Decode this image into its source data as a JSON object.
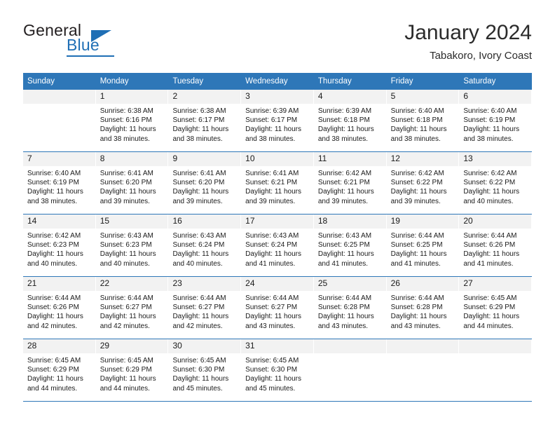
{
  "brand": {
    "word1": "General",
    "word2": "Blue",
    "triangle_color": "#1f6fb5",
    "icon": "triangle-icon"
  },
  "header": {
    "title": "January 2024",
    "subtitle": "Tabakoro, Ivory Coast"
  },
  "theme": {
    "header_bg": "#2e77b8",
    "header_text": "#ffffff",
    "daynum_bg": "#f2f2f2",
    "row_divider": "#2e77b8"
  },
  "weekdays": [
    "Sunday",
    "Monday",
    "Tuesday",
    "Wednesday",
    "Thursday",
    "Friday",
    "Saturday"
  ],
  "weeks": [
    [
      {
        "day": "",
        "sunrise": "",
        "sunset": "",
        "daylight1": "",
        "daylight2": ""
      },
      {
        "day": "1",
        "sunrise": "Sunrise: 6:38 AM",
        "sunset": "Sunset: 6:16 PM",
        "daylight1": "Daylight: 11 hours",
        "daylight2": "and 38 minutes."
      },
      {
        "day": "2",
        "sunrise": "Sunrise: 6:38 AM",
        "sunset": "Sunset: 6:17 PM",
        "daylight1": "Daylight: 11 hours",
        "daylight2": "and 38 minutes."
      },
      {
        "day": "3",
        "sunrise": "Sunrise: 6:39 AM",
        "sunset": "Sunset: 6:17 PM",
        "daylight1": "Daylight: 11 hours",
        "daylight2": "and 38 minutes."
      },
      {
        "day": "4",
        "sunrise": "Sunrise: 6:39 AM",
        "sunset": "Sunset: 6:18 PM",
        "daylight1": "Daylight: 11 hours",
        "daylight2": "and 38 minutes."
      },
      {
        "day": "5",
        "sunrise": "Sunrise: 6:40 AM",
        "sunset": "Sunset: 6:18 PM",
        "daylight1": "Daylight: 11 hours",
        "daylight2": "and 38 minutes."
      },
      {
        "day": "6",
        "sunrise": "Sunrise: 6:40 AM",
        "sunset": "Sunset: 6:19 PM",
        "daylight1": "Daylight: 11 hours",
        "daylight2": "and 38 minutes."
      }
    ],
    [
      {
        "day": "7",
        "sunrise": "Sunrise: 6:40 AM",
        "sunset": "Sunset: 6:19 PM",
        "daylight1": "Daylight: 11 hours",
        "daylight2": "and 38 minutes."
      },
      {
        "day": "8",
        "sunrise": "Sunrise: 6:41 AM",
        "sunset": "Sunset: 6:20 PM",
        "daylight1": "Daylight: 11 hours",
        "daylight2": "and 39 minutes."
      },
      {
        "day": "9",
        "sunrise": "Sunrise: 6:41 AM",
        "sunset": "Sunset: 6:20 PM",
        "daylight1": "Daylight: 11 hours",
        "daylight2": "and 39 minutes."
      },
      {
        "day": "10",
        "sunrise": "Sunrise: 6:41 AM",
        "sunset": "Sunset: 6:21 PM",
        "daylight1": "Daylight: 11 hours",
        "daylight2": "and 39 minutes."
      },
      {
        "day": "11",
        "sunrise": "Sunrise: 6:42 AM",
        "sunset": "Sunset: 6:21 PM",
        "daylight1": "Daylight: 11 hours",
        "daylight2": "and 39 minutes."
      },
      {
        "day": "12",
        "sunrise": "Sunrise: 6:42 AM",
        "sunset": "Sunset: 6:22 PM",
        "daylight1": "Daylight: 11 hours",
        "daylight2": "and 39 minutes."
      },
      {
        "day": "13",
        "sunrise": "Sunrise: 6:42 AM",
        "sunset": "Sunset: 6:22 PM",
        "daylight1": "Daylight: 11 hours",
        "daylight2": "and 40 minutes."
      }
    ],
    [
      {
        "day": "14",
        "sunrise": "Sunrise: 6:42 AM",
        "sunset": "Sunset: 6:23 PM",
        "daylight1": "Daylight: 11 hours",
        "daylight2": "and 40 minutes."
      },
      {
        "day": "15",
        "sunrise": "Sunrise: 6:43 AM",
        "sunset": "Sunset: 6:23 PM",
        "daylight1": "Daylight: 11 hours",
        "daylight2": "and 40 minutes."
      },
      {
        "day": "16",
        "sunrise": "Sunrise: 6:43 AM",
        "sunset": "Sunset: 6:24 PM",
        "daylight1": "Daylight: 11 hours",
        "daylight2": "and 40 minutes."
      },
      {
        "day": "17",
        "sunrise": "Sunrise: 6:43 AM",
        "sunset": "Sunset: 6:24 PM",
        "daylight1": "Daylight: 11 hours",
        "daylight2": "and 41 minutes."
      },
      {
        "day": "18",
        "sunrise": "Sunrise: 6:43 AM",
        "sunset": "Sunset: 6:25 PM",
        "daylight1": "Daylight: 11 hours",
        "daylight2": "and 41 minutes."
      },
      {
        "day": "19",
        "sunrise": "Sunrise: 6:44 AM",
        "sunset": "Sunset: 6:25 PM",
        "daylight1": "Daylight: 11 hours",
        "daylight2": "and 41 minutes."
      },
      {
        "day": "20",
        "sunrise": "Sunrise: 6:44 AM",
        "sunset": "Sunset: 6:26 PM",
        "daylight1": "Daylight: 11 hours",
        "daylight2": "and 41 minutes."
      }
    ],
    [
      {
        "day": "21",
        "sunrise": "Sunrise: 6:44 AM",
        "sunset": "Sunset: 6:26 PM",
        "daylight1": "Daylight: 11 hours",
        "daylight2": "and 42 minutes."
      },
      {
        "day": "22",
        "sunrise": "Sunrise: 6:44 AM",
        "sunset": "Sunset: 6:27 PM",
        "daylight1": "Daylight: 11 hours",
        "daylight2": "and 42 minutes."
      },
      {
        "day": "23",
        "sunrise": "Sunrise: 6:44 AM",
        "sunset": "Sunset: 6:27 PM",
        "daylight1": "Daylight: 11 hours",
        "daylight2": "and 42 minutes."
      },
      {
        "day": "24",
        "sunrise": "Sunrise: 6:44 AM",
        "sunset": "Sunset: 6:27 PM",
        "daylight1": "Daylight: 11 hours",
        "daylight2": "and 43 minutes."
      },
      {
        "day": "25",
        "sunrise": "Sunrise: 6:44 AM",
        "sunset": "Sunset: 6:28 PM",
        "daylight1": "Daylight: 11 hours",
        "daylight2": "and 43 minutes."
      },
      {
        "day": "26",
        "sunrise": "Sunrise: 6:44 AM",
        "sunset": "Sunset: 6:28 PM",
        "daylight1": "Daylight: 11 hours",
        "daylight2": "and 43 minutes."
      },
      {
        "day": "27",
        "sunrise": "Sunrise: 6:45 AM",
        "sunset": "Sunset: 6:29 PM",
        "daylight1": "Daylight: 11 hours",
        "daylight2": "and 44 minutes."
      }
    ],
    [
      {
        "day": "28",
        "sunrise": "Sunrise: 6:45 AM",
        "sunset": "Sunset: 6:29 PM",
        "daylight1": "Daylight: 11 hours",
        "daylight2": "and 44 minutes."
      },
      {
        "day": "29",
        "sunrise": "Sunrise: 6:45 AM",
        "sunset": "Sunset: 6:29 PM",
        "daylight1": "Daylight: 11 hours",
        "daylight2": "and 44 minutes."
      },
      {
        "day": "30",
        "sunrise": "Sunrise: 6:45 AM",
        "sunset": "Sunset: 6:30 PM",
        "daylight1": "Daylight: 11 hours",
        "daylight2": "and 45 minutes."
      },
      {
        "day": "31",
        "sunrise": "Sunrise: 6:45 AM",
        "sunset": "Sunset: 6:30 PM",
        "daylight1": "Daylight: 11 hours",
        "daylight2": "and 45 minutes."
      },
      {
        "day": "",
        "sunrise": "",
        "sunset": "",
        "daylight1": "",
        "daylight2": ""
      },
      {
        "day": "",
        "sunrise": "",
        "sunset": "",
        "daylight1": "",
        "daylight2": ""
      },
      {
        "day": "",
        "sunrise": "",
        "sunset": "",
        "daylight1": "",
        "daylight2": ""
      }
    ]
  ]
}
